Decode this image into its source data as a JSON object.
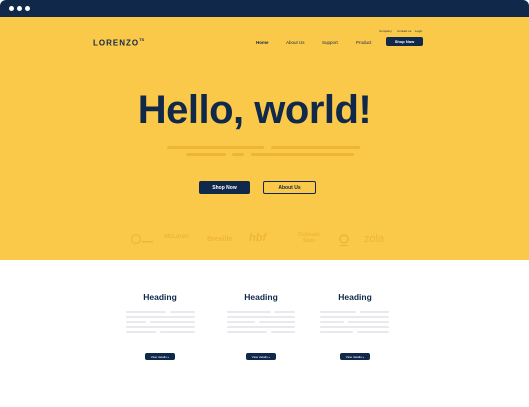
{
  "colors": {
    "navy": "#10284a",
    "yellow": "#fbc94a",
    "yellow_dark": "#efb636",
    "placeholder_gray": "#e7e9ee"
  },
  "window": {
    "controls": [
      "window-dot",
      "window-dot",
      "window-dot"
    ]
  },
  "header": {
    "logo": "LORENZO",
    "logo_sup": "TS",
    "utility_links": [
      "Company",
      "Contact us",
      "Login"
    ],
    "nav": [
      "Home",
      "About Us",
      "Support",
      "Product"
    ],
    "nav_active": "Home",
    "cta": "Shop Now"
  },
  "hero": {
    "headline": "Hello, world!",
    "primary_button": "Shop Now",
    "secondary_button": "About Us"
  },
  "brands": [
    "McLaren",
    "Breville",
    "hbf",
    "Colorado State",
    "zola"
  ],
  "cards": [
    {
      "heading": "Heading",
      "button": "View details »"
    },
    {
      "heading": "Heading",
      "button": "View details »"
    },
    {
      "heading": "Heading",
      "button": "View details »"
    }
  ]
}
